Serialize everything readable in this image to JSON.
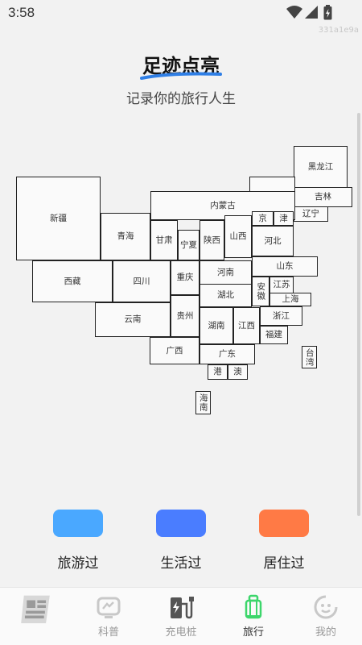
{
  "status_bar": {
    "time": "3:58"
  },
  "watermark": "331a1e9a",
  "header": {
    "title": "足迹点亮",
    "subtitle": "记录你的旅行人生"
  },
  "regions": {
    "heilongjiang": "黑龙江",
    "jilin": "吉林",
    "liaoning": "辽宁",
    "xinjiang": "新疆",
    "neimenggu": "内蒙古",
    "beijing": "京",
    "tianjin": "津",
    "qinghai": "青海",
    "gansu": "甘肃",
    "ningxia": "宁夏",
    "shaanxi": "陕西",
    "shanxi": "山西",
    "hebei": "河北",
    "shandong": "山东",
    "xizang": "西藏",
    "sichuan": "四川",
    "chongqing": "重庆",
    "henan": "河南",
    "anhui": "安徽",
    "jiangsu": "江苏",
    "shanghai": "上海",
    "hubei": "湖北",
    "zhejiang": "浙江",
    "yunnan": "云南",
    "guizhou": "贵州",
    "hunan": "湖南",
    "jiangxi": "江西",
    "fujian": "福建",
    "taiwan": "台湾",
    "guangxi": "广西",
    "guangdong": "广东",
    "hongkong": "港",
    "macau": "澳",
    "hainan": "海南"
  },
  "legend": [
    {
      "label": "旅游过",
      "color": "#4aa8ff"
    },
    {
      "label": "生活过",
      "color": "#4a7dff"
    },
    {
      "label": "居住过",
      "color": "#ff7a45"
    }
  ],
  "tabs": [
    {
      "label": "",
      "icon": "news-tile-icon"
    },
    {
      "label": "科普",
      "icon": "science-tv-icon"
    },
    {
      "label": "充电桩",
      "icon": "charging-pile-icon"
    },
    {
      "label": "旅行",
      "icon": "luggage-icon"
    },
    {
      "label": "我的",
      "icon": "profile-face-icon"
    }
  ],
  "colors": {
    "active_tab": "#3cd66b",
    "title_stroke": "#2f7fe6"
  }
}
